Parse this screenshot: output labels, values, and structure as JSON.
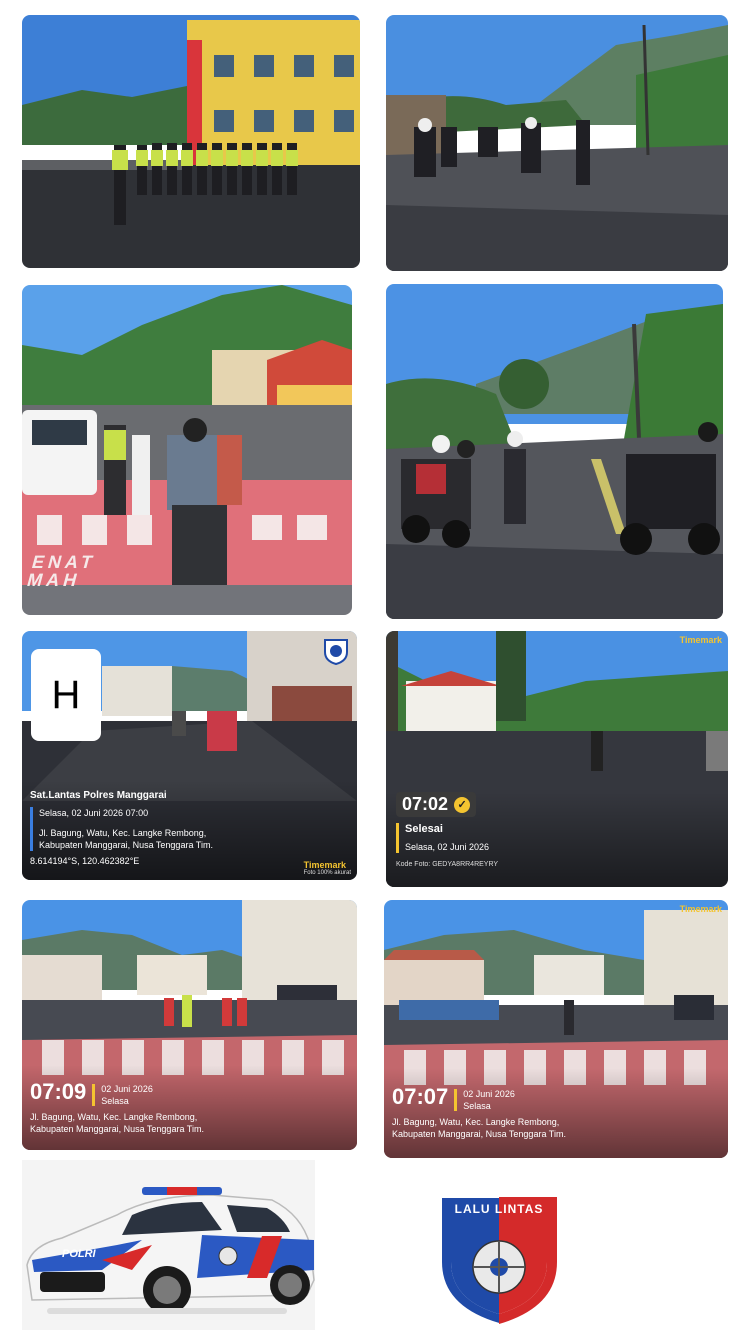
{
  "photos": {
    "p5": {
      "badge": "H",
      "title": "Sat.Lantas Polres Manggarai",
      "datetime": "Selasa, 02 Juni 2026 07:00",
      "address": "Jl. Bagung, Watu, Kec. Langke Rembong, Kabupaten Manggarai, Nusa Tenggara Tim.",
      "coords": "8.614194°S, 120.462382°E",
      "brand": "Timemark",
      "brand_sub": "Foto 100% akurat"
    },
    "p6": {
      "time": "07:02",
      "title": "Selesai",
      "date": "Selasa, 02 Juni 2026",
      "code": "Kode Foto: GEDYA8RR4REYRY",
      "brand": "Timemark"
    },
    "p7": {
      "time": "07:09",
      "date": "02 Juni 2026",
      "day": "Selasa",
      "address": "Jl. Bagung, Watu, Kec. Langke Rembong, Kabupaten Manggarai, Nusa Tenggara Tim."
    },
    "p8": {
      "time": "07:07",
      "date": "02 Juni 2026",
      "day": "Selasa",
      "address": "Jl. Bagung, Watu, Kec. Langke Rembong, Kabupaten Manggarai, Nusa Tenggara Tim.",
      "brand": "Timemark"
    },
    "p3": {
      "road_marking_1": "ENAT",
      "road_marking_2": "MAH"
    }
  },
  "car": {
    "door_text": "POLRI"
  },
  "logo": {
    "text": "LALU LINTAS",
    "colors": {
      "blue": "#1f4aa8",
      "red": "#d42a2a"
    }
  },
  "colors": {
    "timemark_yellow": "#f4c430",
    "crossing_red": "#c85a5a"
  }
}
